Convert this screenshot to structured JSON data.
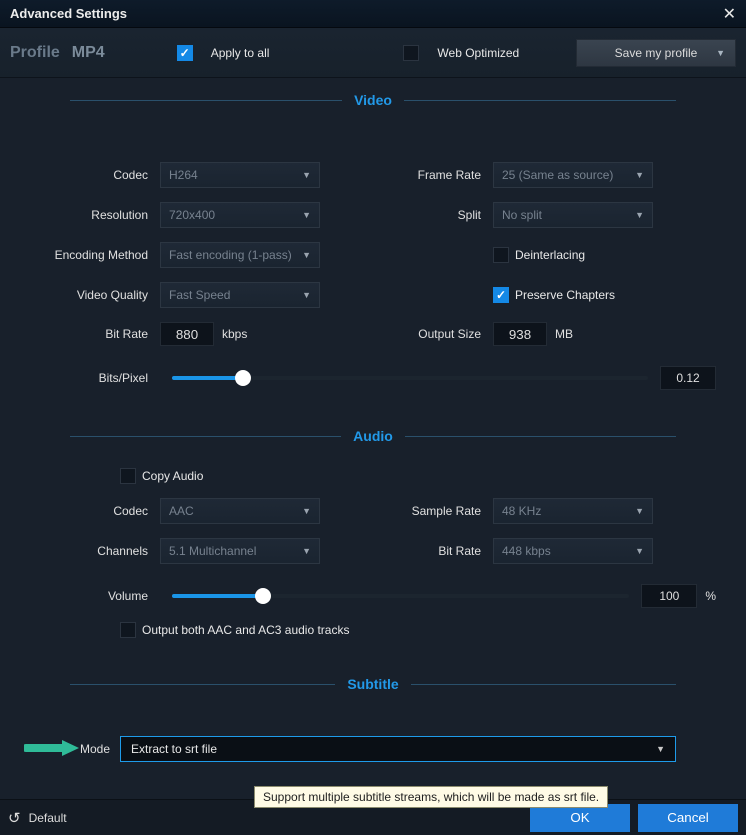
{
  "window_title": "Advanced Settings",
  "profile": {
    "label": "Profile",
    "value": "MP4"
  },
  "topbar": {
    "apply_all": "Apply to all",
    "web_opt": "Web Optimized",
    "save_profile": "Save my profile"
  },
  "sections": {
    "video": "Video",
    "audio": "Audio",
    "subtitle": "Subtitle"
  },
  "video": {
    "codec_label": "Codec",
    "codec_value": "H264",
    "resolution_label": "Resolution",
    "resolution_value": "720x400",
    "encoding_label": "Encoding Method",
    "encoding_value": "Fast encoding (1-pass)",
    "quality_label": "Video Quality",
    "quality_value": "Fast Speed",
    "bitrate_label": "Bit Rate",
    "bitrate_value": "880",
    "bitrate_unit": "kbps",
    "framerate_label": "Frame Rate",
    "framerate_value": "25 (Same as source)",
    "split_label": "Split",
    "split_value": "No split",
    "deinterlacing_label": "Deinterlacing",
    "preserve_chapters_label": "Preserve Chapters",
    "outputsize_label": "Output Size",
    "outputsize_value": "938",
    "outputsize_unit": "MB",
    "bitspixel_label": "Bits/Pixel",
    "bitspixel_value": "0.12"
  },
  "audio": {
    "copy_audio_label": "Copy Audio",
    "codec_label": "Codec",
    "codec_value": "AAC",
    "channels_label": "Channels",
    "channels_value": "5.1 Multichannel",
    "samplerate_label": "Sample Rate",
    "samplerate_value": "48 KHz",
    "bitrate_label": "Bit Rate",
    "bitrate_value": "448 kbps",
    "volume_label": "Volume",
    "volume_value": "100",
    "volume_unit": "%",
    "output_both_label": "Output both AAC and AC3 audio tracks"
  },
  "subtitle": {
    "mode_label": "Mode",
    "mode_value": "Extract to srt file",
    "tooltip": "Support multiple subtitle streams, which will be made as srt file."
  },
  "buttons": {
    "default": "Default",
    "ok": "OK",
    "cancel": "Cancel"
  }
}
